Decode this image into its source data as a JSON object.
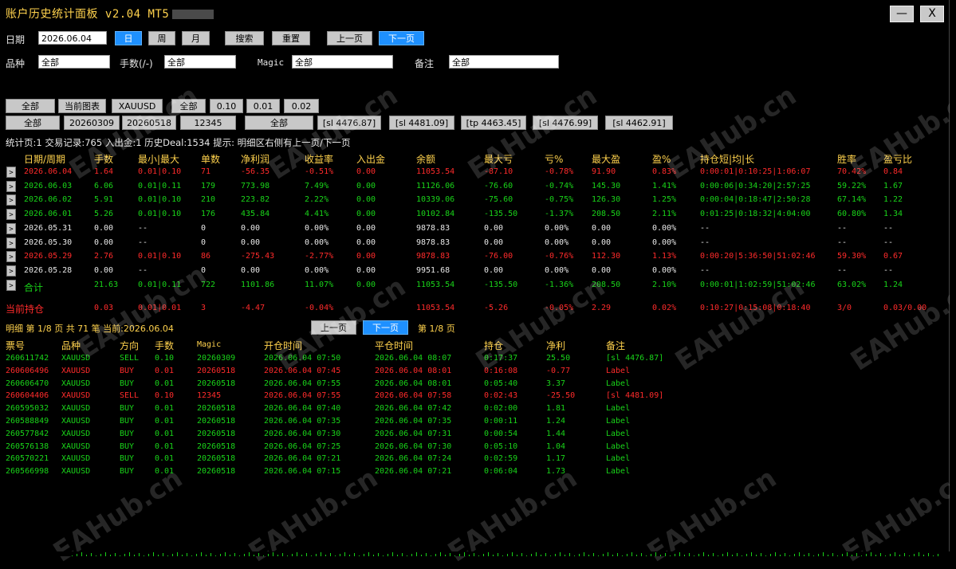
{
  "window": {
    "title": "账户历史统计面板 v2.04 MT5",
    "min_label": "—",
    "close_label": "X"
  },
  "filters": {
    "date_label": "日期",
    "date_value": "2026.06.04",
    "day": "日",
    "week": "周",
    "month": "月",
    "search": "搜索",
    "reset": "重置",
    "prev": "上一页",
    "next": "下一页",
    "symbol_label": "品种",
    "symbol_value": "全部",
    "lots_label": "手数(/-)",
    "lots_value": "全部",
    "magic_label": "Magic",
    "magic_value": "全部",
    "comment_label": "备注",
    "comment_value": "全部"
  },
  "quick_row1": [
    "全部",
    "当前图表",
    "XAUUSD",
    "全部",
    "0.10",
    "0.01",
    "0.02"
  ],
  "quick_row2": [
    "全部",
    "20260309",
    "20260518",
    "12345",
    "全部",
    "[sl 4476.87]",
    "[sl 4481.09]",
    "[tp 4463.45]",
    "[sl 4476.99]",
    "[sl 4462.91]"
  ],
  "stats_line": "统计页:1 交易记录:765 入出金:1 历史Deal:1534  提示: 明细区右侧有上一页/下一页",
  "summary": {
    "headers": [
      "日期/周期",
      "手数",
      "最小|最大",
      "单数",
      "净利润",
      "收益率",
      "入出金",
      "余额",
      "最大亏",
      "亏%",
      "最大盈",
      "盈%",
      "持仓短|均|长",
      "胜率",
      "盈亏比"
    ],
    "rows": [
      {
        "color": "red",
        "cells": [
          "2026.06.04",
          "1.64",
          "0.01|0.10",
          "71",
          "-56.35",
          "-0.51%",
          "0.00",
          "11053.54",
          "-87.10",
          "-0.78%",
          "91.90",
          "0.83%",
          "0:00:01|0:10:25|1:06:07",
          "70.42%",
          "0.84"
        ]
      },
      {
        "color": "green",
        "cells": [
          "2026.06.03",
          "6.06",
          "0.01|0.11",
          "179",
          "773.98",
          "7.49%",
          "0.00",
          "11126.06",
          "-76.60",
          "-0.74%",
          "145.30",
          "1.41%",
          "0:00:06|0:34:20|2:57:25",
          "59.22%",
          "1.67"
        ]
      },
      {
        "color": "green",
        "cells": [
          "2026.06.02",
          "5.91",
          "0.01|0.10",
          "210",
          "223.82",
          "2.22%",
          "0.00",
          "10339.06",
          "-75.60",
          "-0.75%",
          "126.30",
          "1.25%",
          "0:00:04|0:18:47|2:50:28",
          "67.14%",
          "1.22"
        ]
      },
      {
        "color": "green",
        "cells": [
          "2026.06.01",
          "5.26",
          "0.01|0.10",
          "176",
          "435.84",
          "4.41%",
          "0.00",
          "10102.84",
          "-135.50",
          "-1.37%",
          "208.50",
          "2.11%",
          "0:01:25|0:18:32|4:04:00",
          "60.80%",
          "1.34"
        ]
      },
      {
        "color": "white",
        "cells": [
          "2026.05.31",
          "0.00",
          "--",
          "0",
          "0.00",
          "0.00%",
          "0.00",
          "9878.83",
          "0.00",
          "0.00%",
          "0.00",
          "0.00%",
          "--",
          "--",
          "--"
        ]
      },
      {
        "color": "white",
        "cells": [
          "2026.05.30",
          "0.00",
          "--",
          "0",
          "0.00",
          "0.00%",
          "0.00",
          "9878.83",
          "0.00",
          "0.00%",
          "0.00",
          "0.00%",
          "--",
          "--",
          "--"
        ]
      },
      {
        "color": "red",
        "cells": [
          "2026.05.29",
          "2.76",
          "0.01|0.10",
          "86",
          "-275.43",
          "-2.77%",
          "0.00",
          "9878.83",
          "-76.00",
          "-0.76%",
          "112.30",
          "1.13%",
          "0:00:20|5:36:50|51:02:46",
          "59.30%",
          "0.67"
        ]
      },
      {
        "color": "white",
        "cells": [
          "2026.05.28",
          "0.00",
          "--",
          "0",
          "0.00",
          "0.00%",
          "0.00",
          "9951.68",
          "0.00",
          "0.00%",
          "0.00",
          "0.00%",
          "--",
          "--",
          "--"
        ]
      },
      {
        "color": "green",
        "cells": [
          "合计",
          "21.63",
          "0.01|0.11",
          "722",
          "1101.86",
          "11.07%",
          "0.00",
          "11053.54",
          "-135.50",
          "-1.36%",
          "208.50",
          "2.10%",
          "0:00:01|1:02:59|51:02:46",
          "63.02%",
          "1.24"
        ]
      }
    ],
    "current": {
      "label": "当前持仓",
      "cells": [
        "0.03",
        "0.01|0.01",
        "3",
        "-4.47",
        "-0.04%",
        "",
        "11053.54",
        "-5.26",
        "-0.05%",
        "2.29",
        "0.02%",
        "0:10:27|0:15:08|0:18:40",
        "3/0",
        "0.03/0.00"
      ]
    }
  },
  "detail": {
    "info": "明细 第 1/8 页  共 71 笔  当前:2026.06.04",
    "prev": "上一页",
    "next": "下一页",
    "page": "第 1/8 页",
    "headers": [
      "票号",
      "品种",
      "方向",
      "手数",
      "Magic",
      "开仓时间",
      "平仓时间",
      "持仓",
      "净利",
      "备注"
    ],
    "rows": [
      {
        "color": "green",
        "cells": [
          "260611742",
          "XAUUSD",
          "SELL",
          "0.10",
          "20260309",
          "2026.06.04 07:50",
          "2026.06.04 08:07",
          "0:17:37",
          "25.50",
          "[sl 4476.87]"
        ]
      },
      {
        "color": "red",
        "cells": [
          "260606496",
          "XAUUSD",
          "BUY",
          "0.01",
          "20260518",
          "2026.06.04 07:45",
          "2026.06.04 08:01",
          "0:16:08",
          "-0.77",
          "Label"
        ]
      },
      {
        "color": "green",
        "cells": [
          "260606470",
          "XAUUSD",
          "BUY",
          "0.01",
          "20260518",
          "2026.06.04 07:55",
          "2026.06.04 08:01",
          "0:05:40",
          "3.37",
          "Label"
        ]
      },
      {
        "color": "red",
        "cells": [
          "260604406",
          "XAUUSD",
          "SELL",
          "0.10",
          "12345",
          "2026.06.04 07:55",
          "2026.06.04 07:58",
          "0:02:43",
          "-25.50",
          "[sl 4481.09]"
        ]
      },
      {
        "color": "green",
        "cells": [
          "260595032",
          "XAUUSD",
          "BUY",
          "0.01",
          "20260518",
          "2026.06.04 07:40",
          "2026.06.04 07:42",
          "0:02:00",
          "1.81",
          "Label"
        ]
      },
      {
        "color": "green",
        "cells": [
          "260588849",
          "XAUUSD",
          "BUY",
          "0.01",
          "20260518",
          "2026.06.04 07:35",
          "2026.06.04 07:35",
          "0:00:11",
          "1.24",
          "Label"
        ]
      },
      {
        "color": "green",
        "cells": [
          "260577842",
          "XAUUSD",
          "BUY",
          "0.01",
          "20260518",
          "2026.06.04 07:30",
          "2026.06.04 07:31",
          "0:00:54",
          "1.44",
          "Label"
        ]
      },
      {
        "color": "green",
        "cells": [
          "260576138",
          "XAUUSD",
          "BUY",
          "0.01",
          "20260518",
          "2026.06.04 07:25",
          "2026.06.04 07:30",
          "0:05:10",
          "1.04",
          "Label"
        ]
      },
      {
        "color": "green",
        "cells": [
          "260570221",
          "XAUUSD",
          "BUY",
          "0.01",
          "20260518",
          "2026.06.04 07:21",
          "2026.06.04 07:24",
          "0:02:59",
          "1.17",
          "Label"
        ]
      },
      {
        "color": "green",
        "cells": [
          "260566998",
          "XAUUSD",
          "BUY",
          "0.01",
          "20260518",
          "2026.06.04 07:15",
          "2026.06.04 07:21",
          "0:06:04",
          "1.73",
          "Label"
        ]
      }
    ]
  },
  "watermark": "EAHub.cn",
  "colors": {
    "accent": "#1e90ff",
    "title": "#ffd24d",
    "profit": "#19d419",
    "loss": "#ff2b2b"
  }
}
